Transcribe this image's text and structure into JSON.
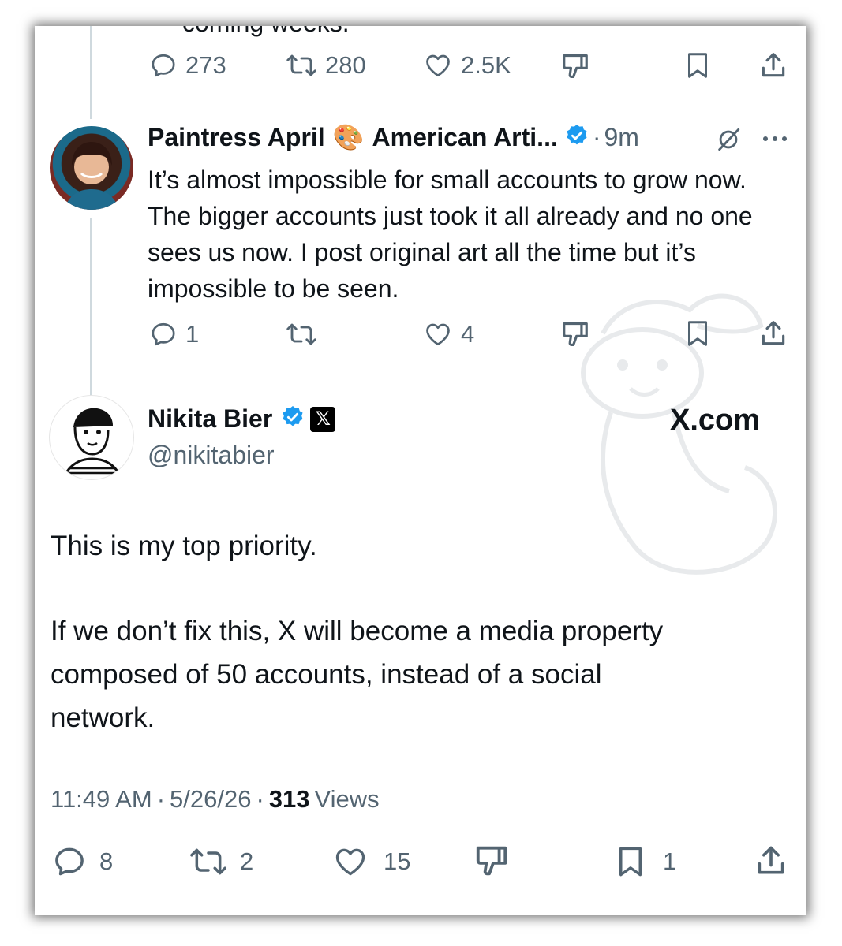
{
  "previous_post": {
    "cut_text": "coming weeks.",
    "actions": {
      "replies": "273",
      "reposts": "280",
      "likes": "2.5K"
    }
  },
  "reply": {
    "name": "Paintress April",
    "name_emoji": "🎨",
    "name_suffix": "American Arti...",
    "dot": "·",
    "time": "9m",
    "text": "It’s almost impossible for small accounts to grow now. The bigger accounts just took it all already and no one sees us now. I post original art all the time but it’s impossible to be seen.",
    "actions": {
      "replies": "1",
      "reposts": "",
      "likes": "4"
    }
  },
  "main_post": {
    "name": "Nikita Bier",
    "handle": "@nikitabier",
    "x_badge": "𝕏",
    "watermark": "X.com",
    "text_line1": "This is my top priority.",
    "text_lines": [
      "If we don’t fix this, X will become a media property",
      "composed of 50 accounts, instead of a social",
      "network."
    ],
    "time": "11:49 AM",
    "dot": "·",
    "date": "5/26/26",
    "views_count": "313",
    "views_label": "Views",
    "actions": {
      "replies": "8",
      "reposts": "2",
      "likes": "15",
      "bookmarks": "1"
    }
  },
  "colors": {
    "verified": "#1d9bf0",
    "muted": "#536471",
    "text": "#0f1419",
    "thread_line": "#cfd9de"
  }
}
